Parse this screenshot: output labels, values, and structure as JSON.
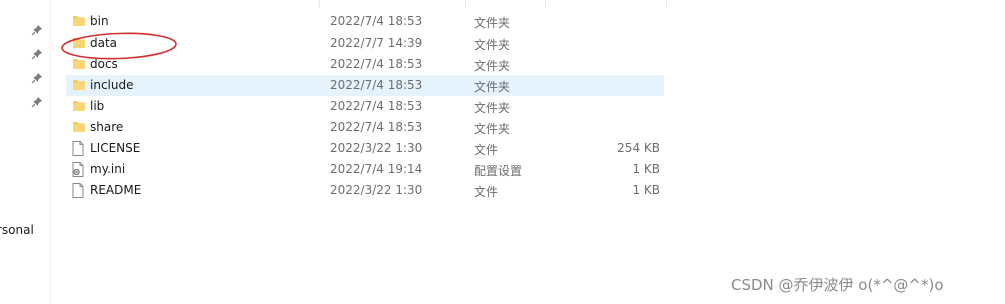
{
  "navigation": {
    "pinned_count": 4,
    "partial_label": "rsonal"
  },
  "files": [
    {
      "name": "bin",
      "date": "2022/7/4 18:53",
      "type": "文件夹",
      "size": "",
      "icon": "folder-icon"
    },
    {
      "name": "data",
      "date": "2022/7/7 14:39",
      "type": "文件夹",
      "size": "",
      "icon": "folder-icon"
    },
    {
      "name": "docs",
      "date": "2022/7/4 18:53",
      "type": "文件夹",
      "size": "",
      "icon": "folder-icon"
    },
    {
      "name": "include",
      "date": "2022/7/4 18:53",
      "type": "文件夹",
      "size": "",
      "icon": "folder-icon"
    },
    {
      "name": "lib",
      "date": "2022/7/4 18:53",
      "type": "文件夹",
      "size": "",
      "icon": "folder-icon"
    },
    {
      "name": "share",
      "date": "2022/7/4 18:53",
      "type": "文件夹",
      "size": "",
      "icon": "folder-icon"
    },
    {
      "name": "LICENSE",
      "date": "2022/3/22 1:30",
      "type": "文件",
      "size": "254 KB",
      "icon": "file-icon"
    },
    {
      "name": "my.ini",
      "date": "2022/7/4 19:14",
      "type": "配置设置",
      "size": "1 KB",
      "icon": "settings-file-icon"
    },
    {
      "name": "README",
      "date": "2022/3/22 1:30",
      "type": "文件",
      "size": "1 KB",
      "icon": "file-icon"
    }
  ],
  "selected_file": "include",
  "annotation": {
    "target": "data",
    "color": "#d32f2f"
  },
  "watermark": "CSDN @乔伊波伊 o(*^@^*)o",
  "colors": {
    "folder": "#f6c95b",
    "selection": "#e5f3ff"
  }
}
